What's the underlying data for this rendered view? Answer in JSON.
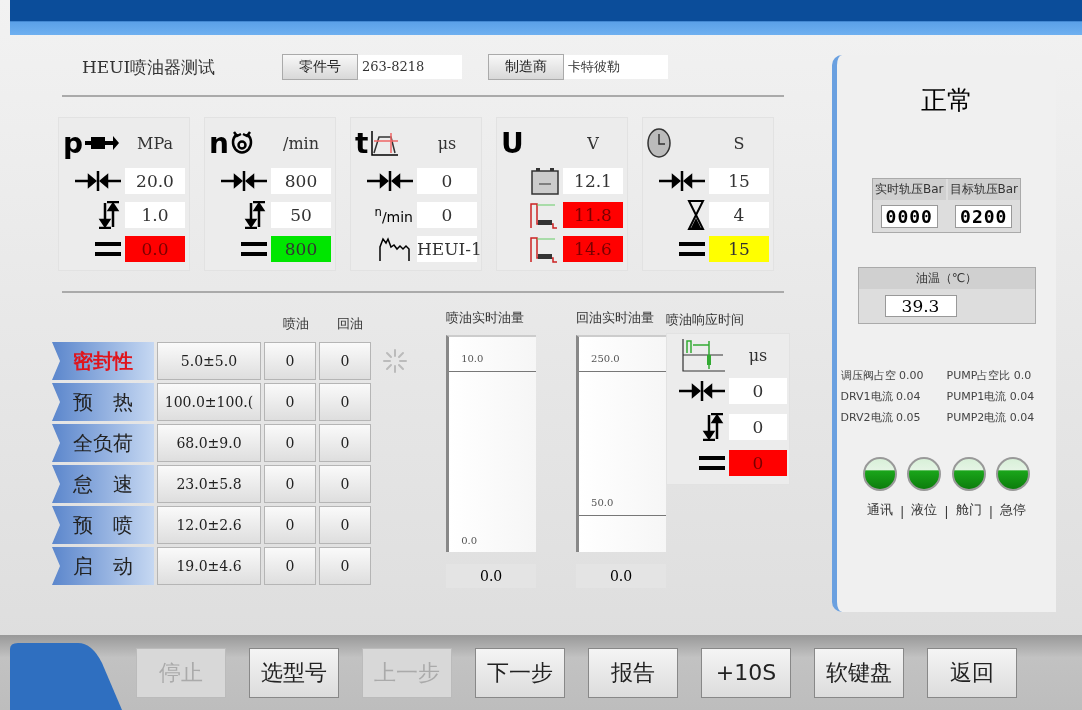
{
  "heading": {
    "title": "HEUI喷油器测试",
    "part_label": "零件号",
    "part_value": "263-8218",
    "maker_label": "制造商",
    "maker_value": "卡特彼勒"
  },
  "gauges": [
    {
      "symbol": "p",
      "kind": "pressure",
      "unit": "MPa",
      "rows": [
        {
          "kind": "target",
          "value": "20.0",
          "color": "#ffffff"
        },
        {
          "kind": "tolerance",
          "value": "1.0",
          "color": "#ffffff"
        },
        {
          "kind": "result",
          "value": "0.0",
          "color": "#ff0000"
        }
      ]
    },
    {
      "symbol": "n",
      "kind": "rotation",
      "unit": "/min",
      "rows": [
        {
          "kind": "target",
          "value": "800",
          "color": "#ffffff"
        },
        {
          "kind": "tolerance",
          "value": "50",
          "color": "#ffffff"
        },
        {
          "kind": "result",
          "value": "800",
          "color": "#00e600"
        }
      ]
    },
    {
      "symbol": "t",
      "kind": "timing",
      "unit": "μs",
      "rows": [
        {
          "kind": "target",
          "value": "0",
          "color": "#ffffff"
        },
        {
          "kind": "label",
          "label": "$^{n}$/min",
          "value": "0",
          "color": "#ffffff"
        },
        {
          "kind": "waveform",
          "value": "HEUI-1",
          "color": "#ffffff"
        }
      ]
    },
    {
      "symbol": "U",
      "kind": "voltage",
      "unit": "V",
      "rows": [
        {
          "kind": "battery",
          "value": "12.1",
          "color": "#ffffff"
        },
        {
          "kind": "boost",
          "value": "11.8",
          "color": "#ff0000"
        },
        {
          "kind": "boost",
          "value": "14.6",
          "color": "#ff0000"
        }
      ]
    },
    {
      "kind": "clock",
      "unit": "S",
      "rows": [
        {
          "kind": "target",
          "value": "15",
          "color": "#ffffff"
        },
        {
          "kind": "hourglass",
          "value": "4",
          "color": "#ffffff"
        },
        {
          "kind": "result",
          "value": "15",
          "color": "#ffff00"
        }
      ]
    }
  ],
  "tests": {
    "columns": [
      "喷油",
      "回油"
    ],
    "rows": [
      {
        "name": "密封性",
        "spec": "5.0±5.0",
        "inject": "0",
        "return": "0",
        "selected": true
      },
      {
        "name": "预　热",
        "spec": "100.0±100.(",
        "inject": "0",
        "return": "0",
        "selected": false
      },
      {
        "name": "全负荷",
        "spec": "68.0±9.0",
        "inject": "0",
        "return": "0",
        "selected": false
      },
      {
        "name": "怠　速",
        "spec": "23.0±5.8",
        "inject": "0",
        "return": "0",
        "selected": false
      },
      {
        "name": "预　喷",
        "spec": "12.0±2.6",
        "inject": "0",
        "return": "0",
        "selected": false
      },
      {
        "name": "启　动",
        "spec": "19.0±4.6",
        "inject": "0",
        "return": "0",
        "selected": false
      }
    ]
  },
  "flows": [
    {
      "title": "喷油实时油量",
      "upper": "10.0",
      "lower": "0.0",
      "reading": "0.0"
    },
    {
      "title": "回油实时油量",
      "upper": "250.0",
      "lower": "50.0",
      "reading": "0.0"
    }
  ],
  "response": {
    "title": "喷油响应时间",
    "unit": "μs",
    "rows": [
      {
        "kind": "target",
        "value": "0",
        "color": "#ffffff"
      },
      {
        "kind": "tolerance",
        "value": "0",
        "color": "#ffffff"
      },
      {
        "kind": "result",
        "value": "0",
        "color": "#ff0000"
      }
    ]
  },
  "side": {
    "status": "正常",
    "rail": [
      {
        "label": "实时轨压Bar",
        "value": "0000"
      },
      {
        "label": "目标轨压Bar",
        "value": "0200"
      }
    ],
    "oil_temp": {
      "label": "油温（℃）",
      "value": "39.3"
    },
    "stats": [
      {
        "label": "调压阀占空",
        "value": "0.00"
      },
      {
        "label": "PUMP占空比",
        "value": "0.0"
      },
      {
        "label": "DRV1电流",
        "value": "0.04"
      },
      {
        "label": "PUMP1电流",
        "value": "0.04"
      },
      {
        "label": "DRV2电流",
        "value": "0.05"
      },
      {
        "label": "PUMP2电流",
        "value": "0.04"
      }
    ],
    "lights": [
      {
        "label": "通讯",
        "on": true
      },
      {
        "label": "液位",
        "on": true
      },
      {
        "label": "舱门",
        "on": true
      },
      {
        "label": "急停",
        "on": true
      }
    ],
    "separator": "|"
  },
  "buttons": [
    {
      "label": "停止",
      "disabled": true
    },
    {
      "label": "选型号",
      "disabled": false
    },
    {
      "label": "上一步",
      "disabled": true
    },
    {
      "label": "下一步",
      "disabled": false
    },
    {
      "label": "报告",
      "disabled": false
    },
    {
      "label": "+10S",
      "disabled": false
    },
    {
      "label": "软键盘",
      "disabled": false
    },
    {
      "label": "返回",
      "disabled": false
    }
  ]
}
